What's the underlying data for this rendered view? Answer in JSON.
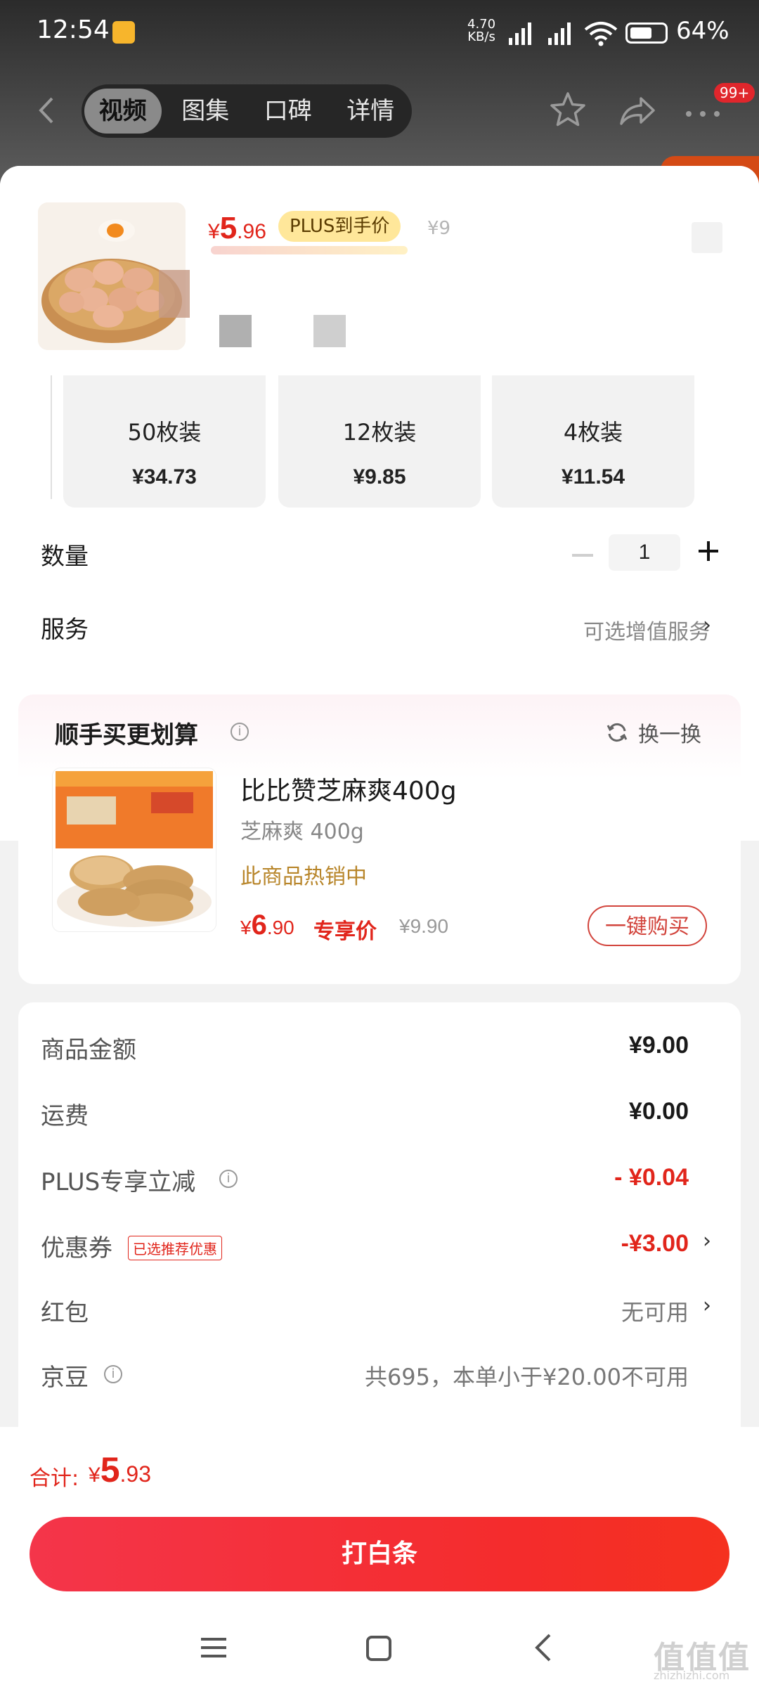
{
  "status_bar": {
    "time": "12:54",
    "net_speed_top": "4.70",
    "net_speed_bottom": "KB/s",
    "battery": "64%"
  },
  "nav": {
    "tabs": [
      "视频",
      "图集",
      "口碑",
      "详情"
    ],
    "active_tab": 0,
    "badge": "99+"
  },
  "product": {
    "price_symbol": "¥",
    "price_int": "5",
    "price_dec": ".96",
    "plus_tag": "PLUS到手价",
    "old_price": "¥9"
  },
  "variants": [
    {
      "name": "50枚装",
      "price": "¥34.73"
    },
    {
      "name": "12枚装",
      "price": "¥9.85"
    },
    {
      "name": "4枚装",
      "price": "¥11.54"
    }
  ],
  "quantity": {
    "label": "数量",
    "value": "1"
  },
  "service": {
    "label": "服务",
    "value": "可选增值服务"
  },
  "recommend": {
    "title": "顺手买更划算",
    "refresh": "换一换",
    "name": "比比赞芝麻爽400g",
    "spec": "芝麻爽 400g",
    "hot": "此商品热销中",
    "price_symbol": "¥",
    "price_int": "6",
    "price_dec": ".90",
    "exclusive": "专享价",
    "old_price": "¥9.90",
    "buy": "一键购买"
  },
  "summary": {
    "goods_label": "商品金额",
    "goods_value": "¥9.00",
    "shipping_label": "运费",
    "shipping_value": "¥0.00",
    "plus_label": "PLUS专享立减",
    "plus_value": "- ¥0.04",
    "coupon_label": "优惠券",
    "coupon_tag": "已选推荐优惠",
    "coupon_value": "-¥3.00",
    "redpacket_label": "红包",
    "redpacket_value": "无可用",
    "jingdou_label": "京豆",
    "jingdou_value": "共695，本单小于¥20.00不可用"
  },
  "checkout": {
    "total_label": "合计:",
    "total_symbol": "¥",
    "total_int": "5",
    "total_dec": ".93",
    "pay_button": "打白条"
  },
  "watermark": {
    "text": "值值值",
    "url": "zhizhizhi.com"
  },
  "colors": {
    "accent_red": "#e1251b",
    "plus_yellow": "#ffe79a",
    "hot_gold": "#b8862b"
  }
}
